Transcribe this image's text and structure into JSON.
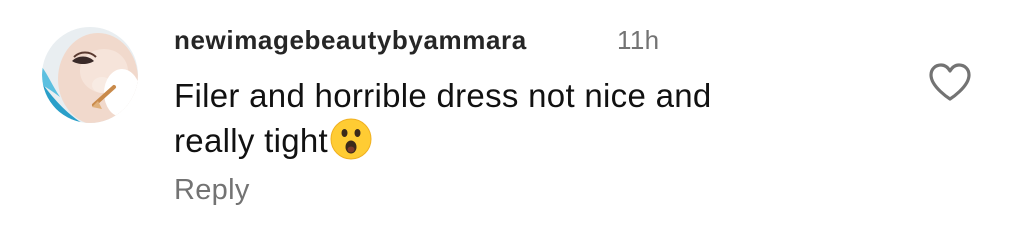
{
  "comment": {
    "username": "newimagebeautybyammara",
    "timestamp": "11h",
    "line1": "Filer and horrible dress not nice and",
    "line2": "really tight",
    "emoji": "astonished-face",
    "reply_label": "Reply",
    "like_icon": "heart-outline-icon"
  },
  "colors": {
    "username": "#262626",
    "secondary_text": "#737373",
    "body_text": "#111111",
    "background": "#ffffff"
  }
}
